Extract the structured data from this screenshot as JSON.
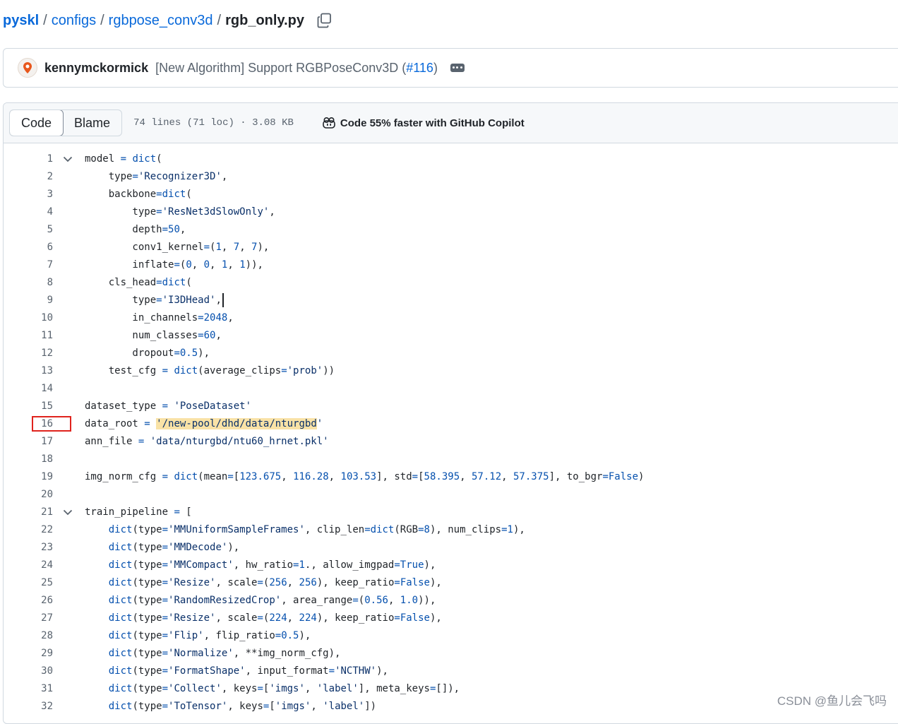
{
  "breadcrumb": {
    "items": [
      "pyskl",
      "configs",
      "rgbpose_conv3d"
    ],
    "separator": "/",
    "current": "rgb_only.py"
  },
  "commit": {
    "author": "kennymckormick",
    "message": "[New Algorithm] Support RGBPoseConv3D (",
    "pr": "#116",
    "message_end": ")"
  },
  "file_header": {
    "tabs": [
      "Code",
      "Blame"
    ],
    "active_tab": "Code",
    "meta": "74 lines (71 loc) · 3.08 KB",
    "copilot": "Code 55% faster with GitHub Copilot"
  },
  "code_lines": [
    {
      "n": "1",
      "fold": true,
      "src": "model = dict("
    },
    {
      "n": "2",
      "src": "    type='Recognizer3D',"
    },
    {
      "n": "3",
      "src": "    backbone=dict("
    },
    {
      "n": "4",
      "src": "        type='ResNet3dSlowOnly',"
    },
    {
      "n": "5",
      "src": "        depth=50,"
    },
    {
      "n": "6",
      "src": "        conv1_kernel=(1, 7, 7),"
    },
    {
      "n": "7",
      "src": "        inflate=(0, 0, 1, 1)),"
    },
    {
      "n": "8",
      "src": "    cls_head=dict("
    },
    {
      "n": "9",
      "src": "        type='I3DHead',"
    },
    {
      "n": "10",
      "src": "        in_channels=2048,"
    },
    {
      "n": "11",
      "src": "        num_classes=60,"
    },
    {
      "n": "12",
      "src": "        dropout=0.5),"
    },
    {
      "n": "13",
      "src": "    test_cfg = dict(average_clips='prob'))"
    },
    {
      "n": "14",
      "src": ""
    },
    {
      "n": "15",
      "src": "dataset_type = 'PoseDataset'"
    },
    {
      "n": "16",
      "src": "data_root = '/new-pool/dhd/data/nturgbd'"
    },
    {
      "n": "17",
      "src": "ann_file = 'data/nturgbd/ntu60_hrnet.pkl'"
    },
    {
      "n": "18",
      "src": ""
    },
    {
      "n": "19",
      "src": "img_norm_cfg = dict(mean=[123.675, 116.28, 103.53], std=[58.395, 57.12, 57.375], to_bgr=False)"
    },
    {
      "n": "20",
      "src": ""
    },
    {
      "n": "21",
      "fold": true,
      "src": "train_pipeline = ["
    },
    {
      "n": "22",
      "src": "    dict(type='MMUniformSampleFrames', clip_len=dict(RGB=8), num_clips=1),"
    },
    {
      "n": "23",
      "src": "    dict(type='MMDecode'),"
    },
    {
      "n": "24",
      "src": "    dict(type='MMCompact', hw_ratio=1., allow_imgpad=True),"
    },
    {
      "n": "25",
      "src": "    dict(type='Resize', scale=(256, 256), keep_ratio=False),"
    },
    {
      "n": "26",
      "src": "    dict(type='RandomResizedCrop', area_range=(0.56, 1.0)),"
    },
    {
      "n": "27",
      "src": "    dict(type='Resize', scale=(224, 224), keep_ratio=False),"
    },
    {
      "n": "28",
      "src": "    dict(type='Flip', flip_ratio=0.5),"
    },
    {
      "n": "29",
      "src": "    dict(type='Normalize', **img_norm_cfg),"
    },
    {
      "n": "30",
      "src": "    dict(type='FormatShape', input_format='NCTHW'),"
    },
    {
      "n": "31",
      "src": "    dict(type='Collect', keys=['imgs', 'label'], meta_keys=[]),"
    },
    {
      "n": "32",
      "src": "    dict(type='ToTensor', keys=['imgs', 'label'])"
    }
  ],
  "highlight_text": "'/new-pool/dhd/data/nturgbd",
  "watermark": "CSDN @鱼儿会飞吗",
  "colors": {
    "link": "#0969da",
    "annotation_box": "#e0231d",
    "highlight": "#f9e2a6"
  }
}
